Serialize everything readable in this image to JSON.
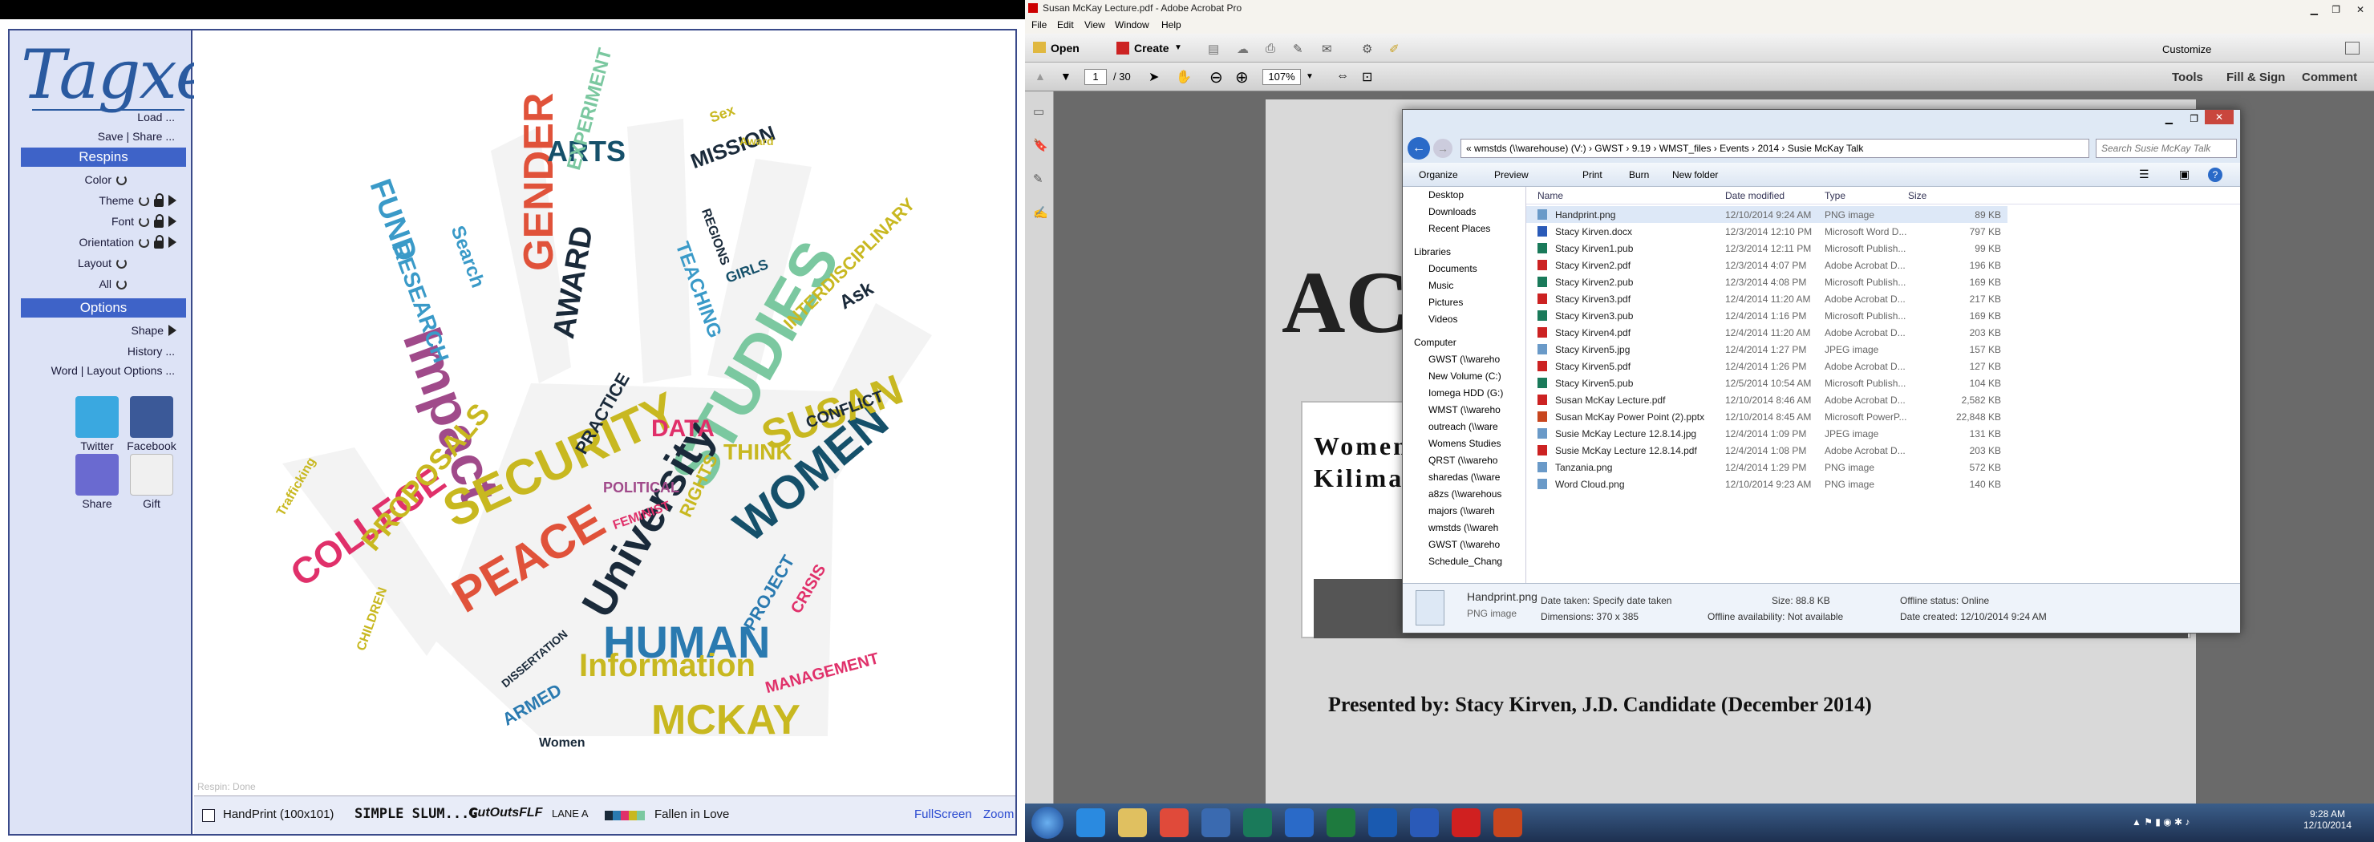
{
  "tagxedo": {
    "logo": "Tagxedo",
    "links": {
      "load": "Load ...",
      "save_share": "Save | Share ..."
    },
    "respins": {
      "header": "Respins",
      "items": [
        "Color",
        "Theme",
        "Font",
        "Orientation",
        "Layout",
        "All"
      ]
    },
    "options": {
      "header": "Options",
      "shape": "Shape",
      "history": "History ...",
      "word_layout": "Word | Layout Options ..."
    },
    "social": {
      "twitter": "Twitter",
      "facebook": "Facebook",
      "share": "Share",
      "gift": "Gift"
    },
    "status": {
      "respin": "Respin: Done",
      "shape_name": "HandPrint (100x101)",
      "font1": "SIMPLE SLUM...G",
      "font2": "CutOutsFLF",
      "font3": "LANE A",
      "theme": "Fallen in Love",
      "fullscreen": "FullScreen",
      "zoom": "Zoom"
    },
    "cloud_words": [
      {
        "t": "GENDER",
        "c": "#e0523a"
      },
      {
        "t": "STUDIES",
        "c": "#7bc8a0"
      },
      {
        "t": "Impact",
        "c": "#a04a8a"
      },
      {
        "t": "SECURITY",
        "c": "#c8b820"
      },
      {
        "t": "PEACE",
        "c": "#e0523a"
      },
      {
        "t": "HUMAN",
        "c": "#2a7ab0"
      },
      {
        "t": "WOMEN",
        "c": "#15506a"
      },
      {
        "t": "University",
        "c": "#1a2a3a"
      },
      {
        "t": "SUSAN",
        "c": "#c8b820"
      },
      {
        "t": "Information",
        "c": "#c8b820"
      },
      {
        "t": "MCKAY",
        "c": "#c8b820"
      },
      {
        "t": "COLLEGE",
        "c": "#e0306a"
      },
      {
        "t": "PROPOSALS",
        "c": "#c8b820"
      },
      {
        "t": "FUND",
        "c": "#3a9ac8"
      },
      {
        "t": "RESEARCH",
        "c": "#3a9ac8"
      },
      {
        "t": "ARTS",
        "c": "#15506a"
      },
      {
        "t": "AWARD",
        "c": "#1a2a3a"
      },
      {
        "t": "EXPERIMENT",
        "c": "#7bc8a0"
      },
      {
        "t": "MISSION",
        "c": "#1a2a3a"
      },
      {
        "t": "TEACHING",
        "c": "#3a9ac8"
      },
      {
        "t": "INTERDISCIPLINARY",
        "c": "#c8b820"
      },
      {
        "t": "CONFLICT",
        "c": "#1a2a3a"
      },
      {
        "t": "Ask",
        "c": "#1a2a3a"
      },
      {
        "t": "DATA",
        "c": "#e0306a"
      },
      {
        "t": "PRACTICE",
        "c": "#1a2a3a"
      },
      {
        "t": "THINK",
        "c": "#c8b820"
      },
      {
        "t": "PROJECT",
        "c": "#2a7ab0"
      },
      {
        "t": "CRISIS",
        "c": "#e0306a"
      },
      {
        "t": "MANAGEMENT",
        "c": "#e0306a"
      },
      {
        "t": "ARMED",
        "c": "#2a7ab0"
      },
      {
        "t": "Women",
        "c": "#1a2a3a"
      },
      {
        "t": "RIGHTS",
        "c": "#c8b820"
      },
      {
        "t": "Search",
        "c": "#3a9ac8"
      },
      {
        "t": "Trafficking",
        "c": "#c8b820"
      },
      {
        "t": "Sex",
        "c": "#c8b820"
      },
      {
        "t": "Award",
        "c": "#c8b820"
      },
      {
        "t": "GIRLS",
        "c": "#15506a"
      },
      {
        "t": "REGIONS",
        "c": "#1a2a3a"
      },
      {
        "t": "POLITICAL",
        "c": "#a04a8a"
      },
      {
        "t": "FEMINIST",
        "c": "#e0306a"
      },
      {
        "t": "CHILDREN",
        "c": "#c8b820"
      },
      {
        "t": "DISSERTATION",
        "c": "#1a2a3a"
      }
    ]
  },
  "acrobat": {
    "title": "Susan McKay Lecture.pdf - Adobe Acrobat Pro",
    "menu": [
      "File",
      "Edit",
      "View",
      "Window",
      "Help"
    ],
    "toolbar": {
      "open": "Open",
      "create": "Create",
      "customize": "Customize"
    },
    "page_nav": {
      "current": "1",
      "total": "/ 30",
      "zoom": "107%"
    },
    "panels": [
      "Tools",
      "Fill & Sign",
      "Comment"
    ],
    "pdf": {
      "heading": "ACC",
      "box_line1": "Women",
      "box_line2": "Kilima",
      "presented": "Presented by: Stacy Kirven, J.D. Candidate (December 2014)"
    }
  },
  "explorer": {
    "path": [
      "«",
      "wmstds (\\\\warehouse) (V:)",
      "GWST",
      "9.19",
      "WMST_files",
      "Events",
      "2014",
      "Susie McKay Talk"
    ],
    "search_placeholder": "Search Susie McKay Talk",
    "toolbar": [
      "Organize",
      "Preview",
      "Print",
      "Burn",
      "New folder"
    ],
    "nav": [
      "Desktop",
      "Downloads",
      "Recent Places",
      "Libraries",
      "Documents",
      "Music",
      "Pictures",
      "Videos",
      "Computer",
      "GWST (\\\\wareho",
      "New Volume (C:)",
      "Iomega HDD (G:)",
      "WMST (\\\\wareho",
      "outreach (\\\\ware",
      "Womens Studies",
      "QRST (\\\\wareho",
      "sharedas (\\\\ware",
      "a8zs (\\\\warehous",
      "majors (\\\\wareh",
      "wmstds (\\\\wareh",
      "GWST (\\\\wareho",
      "Schedule_Chang"
    ],
    "columns": [
      "Name",
      "Date modified",
      "Type",
      "Size"
    ],
    "files": [
      [
        "Handprint.png",
        "12/10/2014 9:24 AM",
        "PNG image",
        "89 KB"
      ],
      [
        "Stacy Kirven.docx",
        "12/3/2014 12:10 PM",
        "Microsoft Word D...",
        "797 KB"
      ],
      [
        "Stacy Kirven1.pub",
        "12/3/2014 12:11 PM",
        "Microsoft Publish...",
        "99 KB"
      ],
      [
        "Stacy Kirven2.pdf",
        "12/3/2014 4:07 PM",
        "Adobe Acrobat D...",
        "196 KB"
      ],
      [
        "Stacy Kirven2.pub",
        "12/3/2014 4:08 PM",
        "Microsoft Publish...",
        "169 KB"
      ],
      [
        "Stacy Kirven3.pdf",
        "12/4/2014 11:20 AM",
        "Adobe Acrobat D...",
        "217 KB"
      ],
      [
        "Stacy Kirven3.pub",
        "12/4/2014 1:16 PM",
        "Microsoft Publish...",
        "169 KB"
      ],
      [
        "Stacy Kirven4.pdf",
        "12/4/2014 11:20 AM",
        "Adobe Acrobat D...",
        "203 KB"
      ],
      [
        "Stacy Kirven5.jpg",
        "12/4/2014 1:27 PM",
        "JPEG image",
        "157 KB"
      ],
      [
        "Stacy Kirven5.pdf",
        "12/4/2014 1:26 PM",
        "Adobe Acrobat D...",
        "127 KB"
      ],
      [
        "Stacy Kirven5.pub",
        "12/5/2014 10:54 AM",
        "Microsoft Publish...",
        "104 KB"
      ],
      [
        "Susan McKay Lecture.pdf",
        "12/10/2014 8:46 AM",
        "Adobe Acrobat D...",
        "2,582 KB"
      ],
      [
        "Susan McKay Power Point (2).pptx",
        "12/10/2014 8:45 AM",
        "Microsoft PowerP...",
        "22,848 KB"
      ],
      [
        "Susie McKay Lecture 12.8.14.jpg",
        "12/4/2014 1:09 PM",
        "JPEG image",
        "131 KB"
      ],
      [
        "Susie McKay Lecture 12.8.14.pdf",
        "12/4/2014 1:08 PM",
        "Adobe Acrobat D...",
        "203 KB"
      ],
      [
        "Tanzania.png",
        "12/4/2014 1:29 PM",
        "PNG image",
        "572 KB"
      ],
      [
        "Word Cloud.png",
        "12/10/2014 9:23 AM",
        "PNG image",
        "140 KB"
      ]
    ],
    "details": {
      "name": "Handprint.png",
      "type": "PNG image",
      "date_taken": "Date taken: Specify date taken",
      "dimensions": "Dimensions: 370 x 385",
      "size": "Size: 88.8 KB",
      "offline_avail": "Offline availability: Not available",
      "offline_status": "Offline status: Online",
      "date_created": "Date created: 12/10/2014 9:24 AM"
    }
  },
  "taskbar": {
    "time": "9:28 AM",
    "date": "12/10/2014"
  }
}
